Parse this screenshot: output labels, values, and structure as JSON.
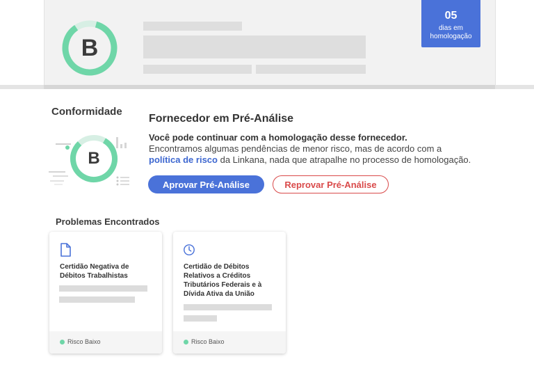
{
  "supplier": {
    "grade": "B",
    "days_badge": {
      "number": "05",
      "label_line1": "dias em",
      "label_line2": "homologação"
    }
  },
  "conformidade": {
    "title": "Conformidade",
    "grade": "B",
    "status_title": "Fornecedor em Pré-Análise",
    "lead": "Você pode continuar com a homologação desse fornecedor.",
    "body_part1": "Encontramos algumas pendências de menor risco, mas de acordo com a",
    "body_link": "política de risco",
    "body_part2": "da Linkana, nada que atrapalhe no processo de homologação.",
    "approve_label": "Aprovar Pré-Análise",
    "reject_label": "Reprovar Pré-Análise"
  },
  "problems": {
    "title": "Problemas Encontrados",
    "cards": [
      {
        "icon": "document-icon",
        "title": "Certidão Negativa de Débitos Trabalhistas",
        "risk": "Risco Baixo"
      },
      {
        "icon": "clock-icon",
        "title": "Certidão de Débitos Relativos a Créditos Tributários Federais e à Dívida Ativa da União",
        "risk": "Risco Baixo"
      }
    ]
  },
  "colors": {
    "accent": "#4a72d9",
    "danger": "#d94a4a",
    "grade_ring": "#6fd6a8",
    "risk_low": "#6fd6a8"
  }
}
